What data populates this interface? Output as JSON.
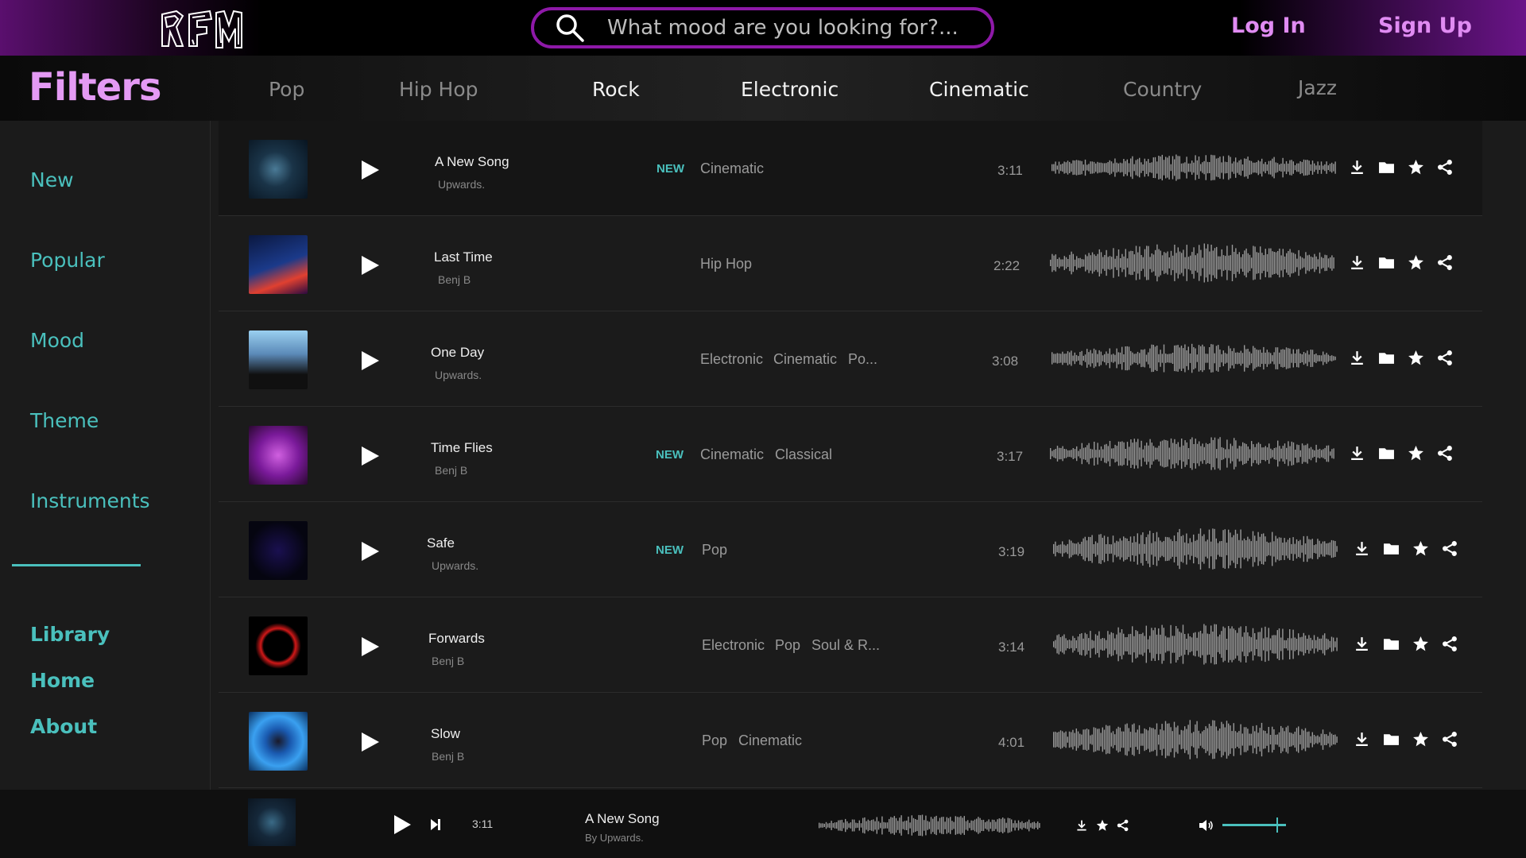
{
  "header": {
    "search_placeholder": "What mood are you looking for?...",
    "login": "Log In",
    "signup": "Sign Up"
  },
  "filters_title": "Filters",
  "genres": [
    {
      "label": "Pop",
      "active": false
    },
    {
      "label": "Hip Hop",
      "active": false
    },
    {
      "label": "Rock",
      "active": true
    },
    {
      "label": "Electronic",
      "active": true
    },
    {
      "label": "Cinematic",
      "active": true
    },
    {
      "label": "Country",
      "active": false
    },
    {
      "label": "Jazz",
      "active": false
    }
  ],
  "sidebar": {
    "items": [
      "New",
      "Popular",
      "Mood",
      "Theme",
      "Instruments"
    ],
    "links": [
      "Library",
      "Home",
      "About"
    ]
  },
  "tracks": [
    {
      "title": "A New Song",
      "artist": "Upwards.",
      "new": "NEW",
      "tags": [
        "Cinematic"
      ],
      "duration": "3:11"
    },
    {
      "title": "Last Time",
      "artist": "Benj B",
      "new": "",
      "tags": [
        "Hip Hop"
      ],
      "duration": "2:22"
    },
    {
      "title": "One Day",
      "artist": "Upwards.",
      "new": "",
      "tags": [
        "Electronic",
        "Cinematic",
        "Po..."
      ],
      "duration": "3:08"
    },
    {
      "title": "Time Flies",
      "artist": "Benj B",
      "new": "NEW",
      "tags": [
        "Cinematic",
        "Classical"
      ],
      "duration": "3:17"
    },
    {
      "title": "Safe",
      "artist": "Upwards.",
      "new": "NEW",
      "tags": [
        "Pop"
      ],
      "duration": "3:19"
    },
    {
      "title": "Forwards",
      "artist": "Benj B",
      "new": "",
      "tags": [
        "Electronic",
        "Pop",
        "Soul & R..."
      ],
      "duration": "3:14"
    },
    {
      "title": "Slow",
      "artist": "Benj B",
      "new": "",
      "tags": [
        "Pop",
        "Cinematic"
      ],
      "duration": "4:01"
    }
  ],
  "player": {
    "time": "3:11",
    "title": "A New Song",
    "artist": "By Upwards.",
    "volume": 0.85
  },
  "colors": {
    "accent_teal": "#4ac0bd",
    "accent_purple": "#e08bf2",
    "search_border": "#8e19a8"
  }
}
